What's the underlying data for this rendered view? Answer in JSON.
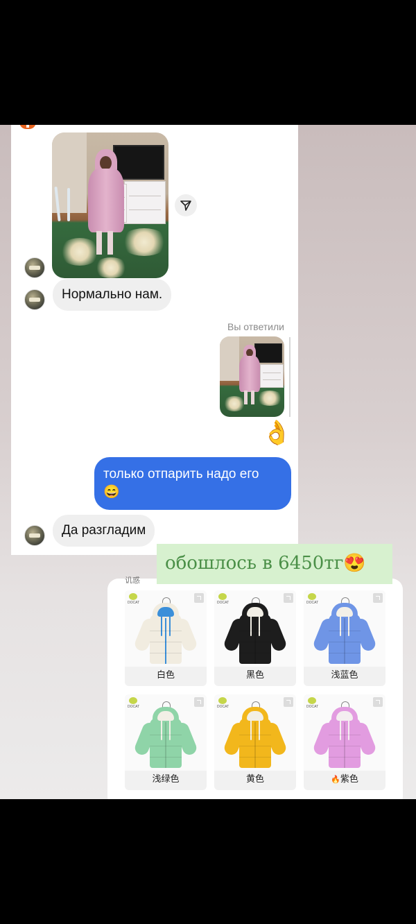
{
  "chat": {
    "messages": {
      "received_1": "Нормально нам.",
      "replied_label": "Вы ответили",
      "ok_emoji": "👌",
      "sent_1": "только отпарить надо его",
      "sent_1_emoji": "😄",
      "received_2": "Да разгладим"
    },
    "send_icon": "paper-plane-icon",
    "colors": {
      "sent_bubble": "#3570e6",
      "received_bubble": "#efefef"
    }
  },
  "caption": {
    "text": "обошлось в 6450тг",
    "emoji": "😍",
    "bg_color": "#d7f1cf",
    "text_color": "#4a8f47"
  },
  "products": {
    "header_peek": "讥惑",
    "brand_tag": "DOCAT",
    "variants": [
      {
        "label": "白色",
        "color": "#f1ece0",
        "accent": "#3b8fd9"
      },
      {
        "label": "黑色",
        "color": "#1d1d1d",
        "accent": "#f2efe6"
      },
      {
        "label": "浅蓝色",
        "color": "#6f95e6",
        "accent": "#f3f0e8"
      },
      {
        "label": "浅绿色",
        "color": "#8fd4a8",
        "accent": "#f2efe6"
      },
      {
        "label": "黄色",
        "color": "#f2b71c",
        "accent": "#f2efe6"
      },
      {
        "label": "紫色",
        "color": "#e29ce0",
        "accent": "#f4eef0",
        "badge": "🔥"
      }
    ]
  }
}
